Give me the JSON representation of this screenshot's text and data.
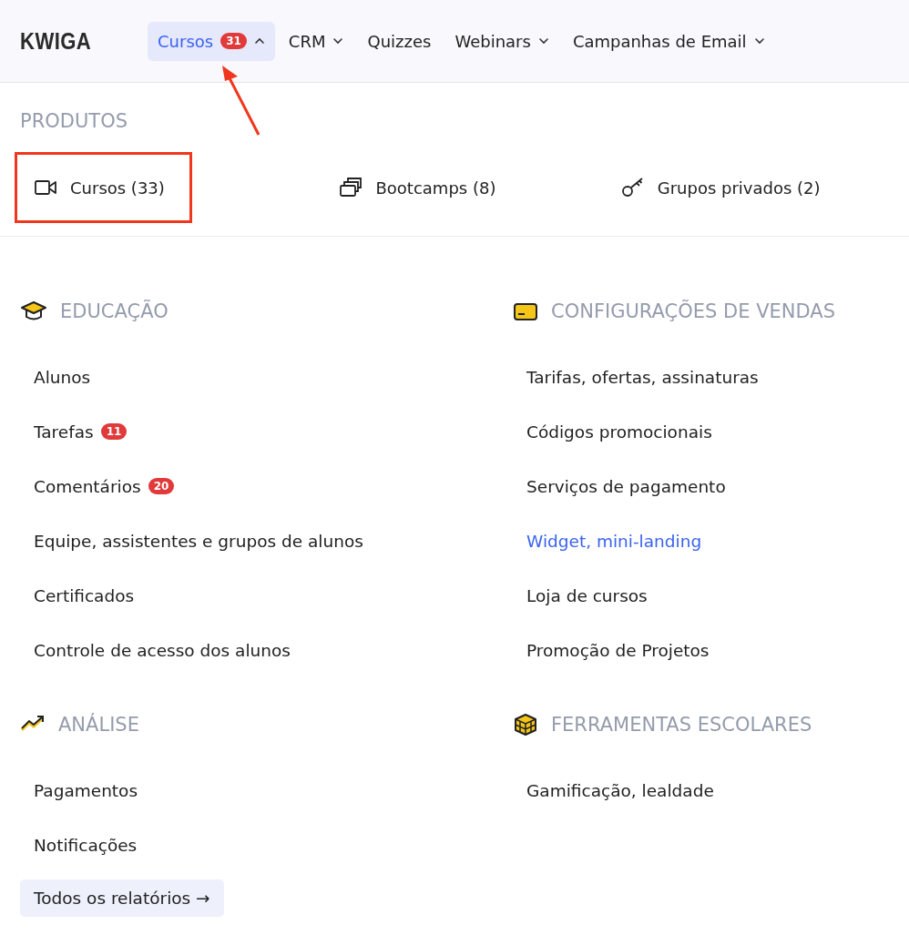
{
  "header": {
    "logo": "KWIGA",
    "nav": [
      {
        "label": "Cursos",
        "badge": "31",
        "dropdown": true,
        "expanded": true,
        "selected": true
      },
      {
        "label": "CRM",
        "dropdown": true,
        "expanded": false,
        "selected": false
      },
      {
        "label": "Quizzes",
        "dropdown": false,
        "selected": false
      },
      {
        "label": "Webinars",
        "dropdown": true,
        "expanded": false,
        "selected": false
      },
      {
        "label": "Campanhas de Email",
        "dropdown": true,
        "expanded": false,
        "selected": false
      }
    ]
  },
  "products": {
    "title": "PRODUTOS",
    "items": [
      {
        "kind": "video",
        "label": "Cursos (33)",
        "highlighted": true
      },
      {
        "kind": "stack",
        "label": "Bootcamps (8)",
        "highlighted": false
      },
      {
        "kind": "key",
        "label": "Grupos privados (2)",
        "highlighted": false
      }
    ]
  },
  "sections": [
    {
      "kind": "education",
      "title": "EDUCAÇÃO",
      "items": [
        {
          "label": "Alunos",
          "selected": false
        },
        {
          "label": "Tarefas",
          "badge": "11",
          "selected": false
        },
        {
          "label": "Comentários",
          "badge": "20",
          "selected": false
        },
        {
          "label": "Equipe, assistentes e grupos de alunos",
          "selected": false
        },
        {
          "label": "Certificados",
          "selected": false
        },
        {
          "label": "Controle de acesso dos alunos",
          "selected": false
        }
      ]
    },
    {
      "kind": "sales",
      "title": "CONFIGURAÇÕES DE VENDAS",
      "items": [
        {
          "label": "Tarifas, ofertas, assinaturas",
          "selected": false
        },
        {
          "label": "Códigos promocionais",
          "selected": false
        },
        {
          "label": "Serviços de pagamento",
          "selected": false
        },
        {
          "label": "Widget, mini-landing",
          "selected": true
        },
        {
          "label": "Loja de cursos",
          "selected": false
        },
        {
          "label": "Promoção de Projetos",
          "selected": false
        }
      ]
    },
    {
      "kind": "analytics",
      "title": "ANÁLISE",
      "items": [
        {
          "label": "Pagamentos",
          "selected": false
        },
        {
          "label": "Notificações",
          "selected": false
        }
      ],
      "footer_link": "Todos os relatórios →"
    },
    {
      "kind": "tools",
      "title": "FERRAMENTAS ESCOLARES",
      "items": [
        {
          "label": "Gamificação, lealdade",
          "selected": false
        }
      ]
    }
  ]
}
